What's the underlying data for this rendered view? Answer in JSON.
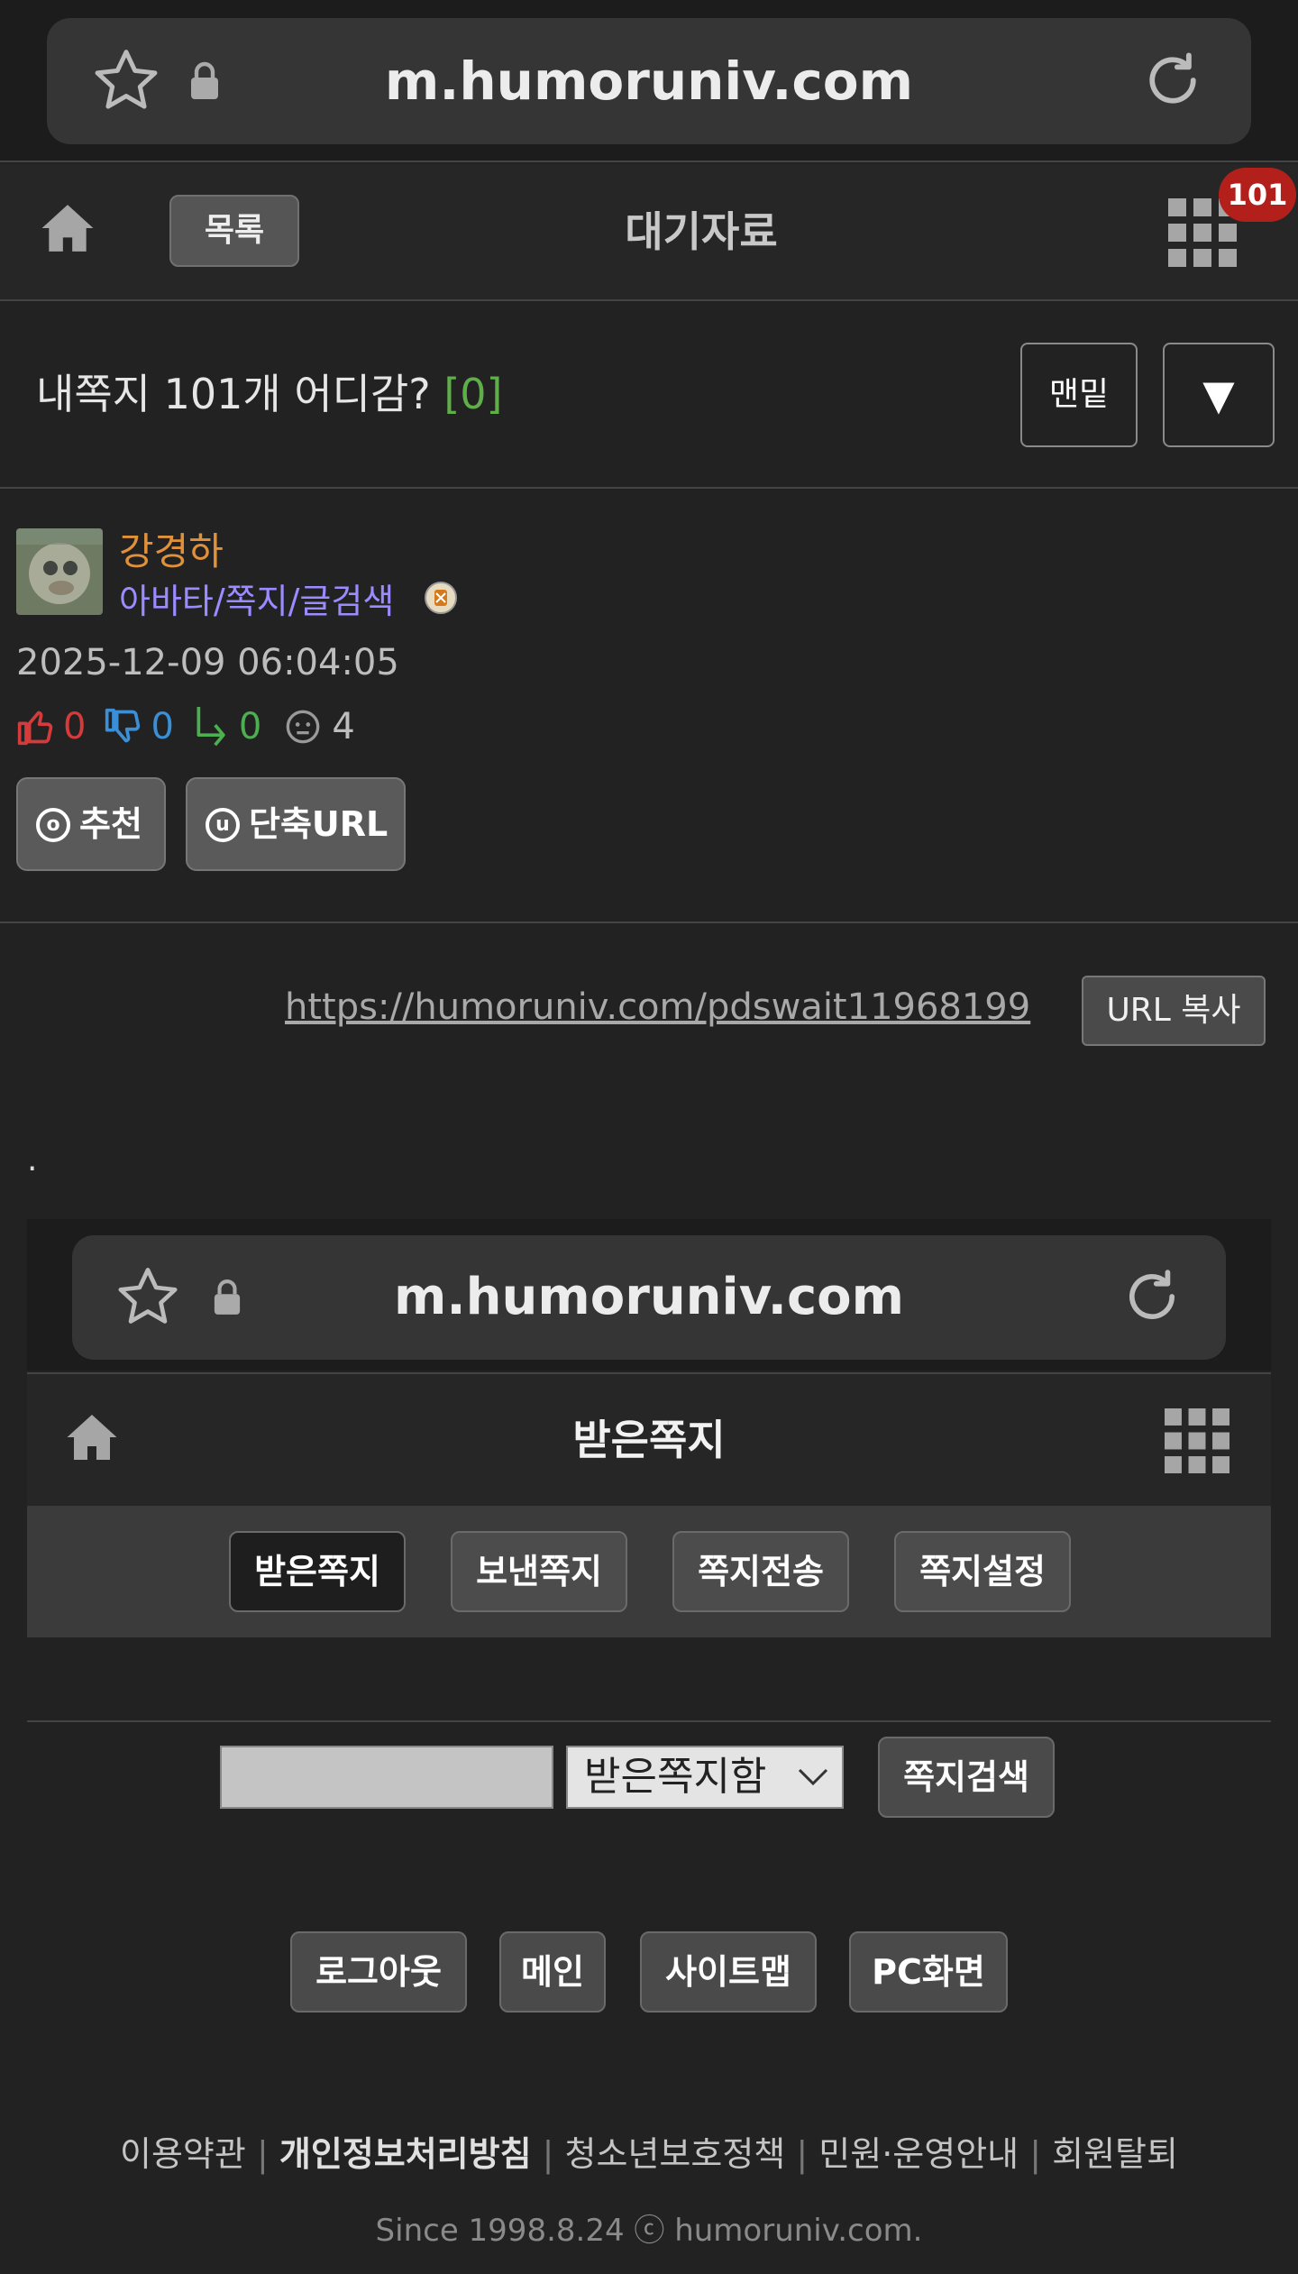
{
  "browser": {
    "url": "m.humoruniv.com"
  },
  "nav": {
    "list_label": "목록",
    "title": "대기자료",
    "notification_count": "101"
  },
  "post": {
    "title": "내쪽지 101개 어디감?",
    "comment_count": "[0]",
    "bottom_button": "맨밑",
    "down_arrow": "▼",
    "author_name": "강경하",
    "author_links": "아바타/쪽지/글검색",
    "datetime": "2025-12-09 06:04:05",
    "likes": "0",
    "dislikes": "0",
    "shares": "0",
    "views": "4",
    "recommend_icon_letter": "o",
    "recommend_label": "추천",
    "short_url_icon_letter": "u",
    "short_url_label": "단축URL",
    "link": "https://humoruniv.com/pdswait11968199",
    "copy_url_label": "URL 복사",
    "body_text": "."
  },
  "embedded": {
    "url": "m.humoruniv.com",
    "title": "받은쪽지",
    "tabs": [
      "받은쪽지",
      "보낸쪽지",
      "쪽지전송",
      "쪽지설정"
    ],
    "search": {
      "input_value": "",
      "select_value": "받은쪽지함",
      "button_label": "쪽지검색"
    },
    "footer_buttons": [
      "로그아웃",
      "메인",
      "사이트맵",
      "PC화면"
    ],
    "footer_links": {
      "terms": "이용약관",
      "privacy": "개인정보처리방침",
      "youth": "청소년보호정책",
      "support": "민원·운영안내",
      "withdraw": "회원탈퇴",
      "sep": "|"
    },
    "copyright": "Since 1998.8.24 ⓒ humoruniv.com."
  },
  "colors": {
    "background": "#222222",
    "author": "#e0913a",
    "links": "#9a8cff",
    "comment_count": "#5fae4a",
    "like": "#d63b3b",
    "dislike": "#3b8fd6",
    "share": "#4caf50",
    "badge": "#b3201c"
  }
}
